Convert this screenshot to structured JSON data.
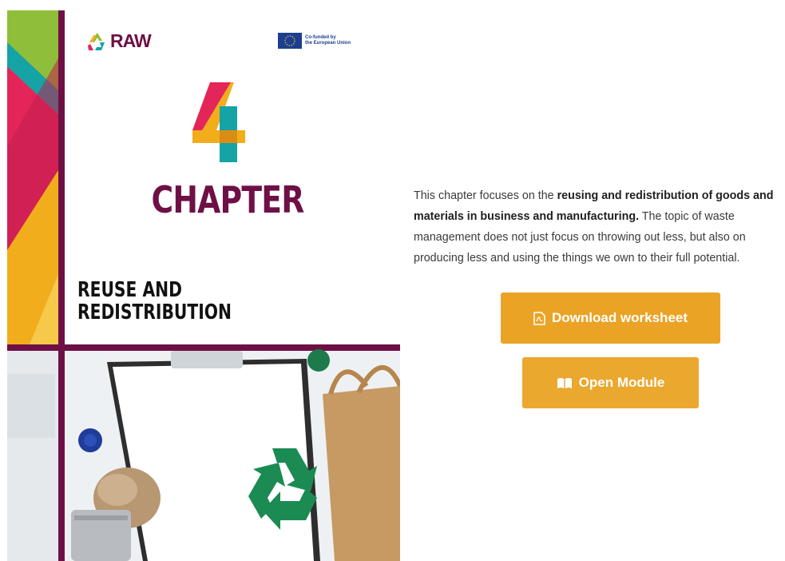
{
  "cover": {
    "logo_text": "RAW",
    "eu_text": "Co-funded by\nthe European Union",
    "chapter_number": "4",
    "chapter_label": "CHAPTER",
    "title_line1": "REUSE AND",
    "title_line2": "REDISTRIBUTION"
  },
  "description": {
    "intro": "This chapter focuses on the ",
    "bold": "reusing and redistribution of goods and materials in business and manufacturing.",
    "rest": " The topic of waste management does not just focus on throwing out less, but also on producing less and using the things we own to their full potential."
  },
  "buttons": {
    "download_label": "Download worksheet",
    "download_icon": "pdf-file-icon",
    "module_label": "Open Module",
    "module_icon": "open-book-icon"
  },
  "colors": {
    "maroon": "#6e1046",
    "button_orange": "#eba325",
    "button_orange_light": "#eba82e"
  }
}
